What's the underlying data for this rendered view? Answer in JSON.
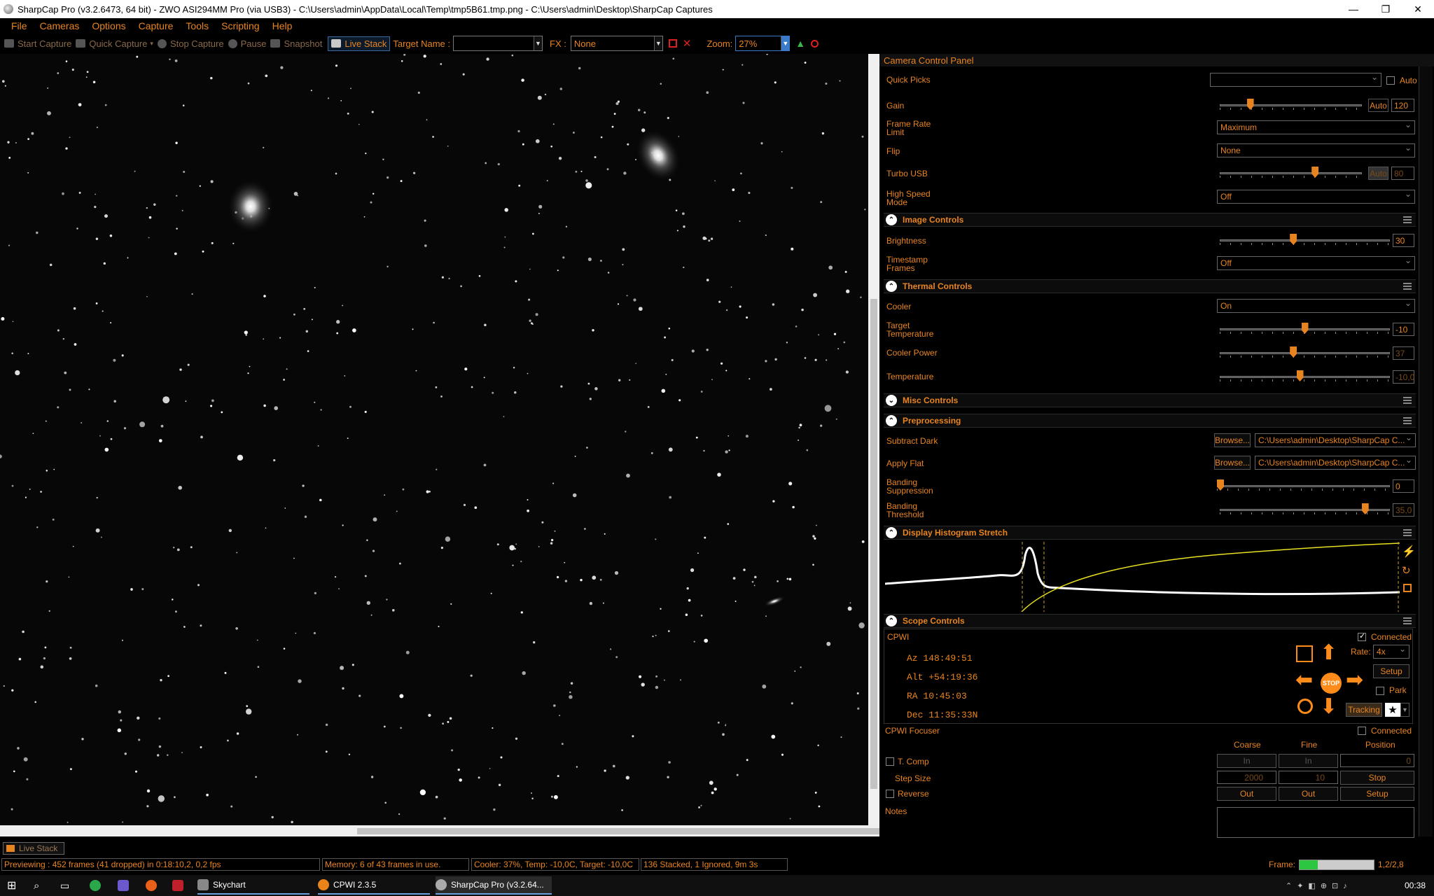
{
  "window": {
    "title": "SharpCap Pro (v3.2.6473, 64 bit) - ZWO ASI294MM Pro (via USB3) - C:\\Users\\admin\\AppData\\Local\\Temp\\tmp5B61.tmp.png - C:\\Users\\admin\\Desktop\\SharpCap Captures",
    "minimize": "—",
    "maximize": "❐",
    "close": "✕"
  },
  "menu": [
    "File",
    "Cameras",
    "Options",
    "Capture",
    "Tools",
    "Scripting",
    "Help"
  ],
  "toolbar": {
    "start_capture": "Start Capture",
    "quick_capture": "Quick Capture",
    "stop_capture": "Stop Capture",
    "pause": "Pause",
    "snapshot": "Snapshot",
    "live_stack": "Live Stack",
    "target_name_label": "Target Name :",
    "target_name_value": "",
    "fx_label": "FX :",
    "fx_value": "None",
    "zoom_label": "Zoom:",
    "zoom_value": "27%"
  },
  "panel": {
    "title": "Camera Control Panel",
    "quick_picks_label": "Quick Picks",
    "quick_picks_value": "",
    "auto_label": "Auto",
    "gain": {
      "label": "Gain",
      "auto": "Auto",
      "value": "120",
      "level": 0.2
    },
    "frame_rate": {
      "label": "Frame Rate Limit",
      "value": "Maximum"
    },
    "flip": {
      "label": "Flip",
      "value": "None"
    },
    "turbo_usb": {
      "label": "Turbo USB",
      "auto": "Auto",
      "value": "80",
      "level": 0.68
    },
    "high_speed": {
      "label": "High Speed Mode",
      "value": "Off"
    },
    "image_controls": {
      "title": "Image Controls",
      "brightness": {
        "label": "Brightness",
        "value": "30",
        "level": 0.43
      },
      "timestamp": {
        "label": "Timestamp Frames",
        "value": "Off"
      }
    },
    "thermal": {
      "title": "Thermal Controls",
      "cooler": {
        "label": "Cooler",
        "value": "On"
      },
      "target_temp": {
        "label": "Target Temperature",
        "value": "-10",
        "level": 0.5
      },
      "cooler_power": {
        "label": "Cooler Power",
        "value": "37",
        "level": 0.43
      },
      "temperature": {
        "label": "Temperature",
        "value": "-10,0",
        "level": 0.47
      }
    },
    "misc": {
      "title": "Misc Controls"
    },
    "preprocessing": {
      "title": "Preprocessing",
      "subtract_dark": {
        "label": "Subtract Dark",
        "browse": "Browse...",
        "value": "C:\\Users\\admin\\Desktop\\SharpCap C..."
      },
      "apply_flat": {
        "label": "Apply Flat",
        "browse": "Browse...",
        "value": "C:\\Users\\admin\\Desktop\\SharpCap C..."
      },
      "banding_suppression": {
        "label": "Banding Suppression",
        "value": "0",
        "level": 0.0
      },
      "banding_threshold": {
        "label": "Banding Threshold",
        "value": "35,0",
        "level": 0.87
      }
    },
    "histogram": {
      "title": "Display Histogram Stretch"
    },
    "scope": {
      "title": "Scope Controls",
      "device": "CPWI",
      "connected_label": "Connected",
      "az": "Az  148:49:51",
      "alt": "Alt +54:19:36",
      "ra": "RA  10:45:03",
      "dec": "Dec 11:35:33N",
      "rate_label": "Rate:",
      "rate_value": "4x",
      "setup": "Setup",
      "park": "Park",
      "tracking": "Tracking",
      "stop": "STOP"
    },
    "focuser": {
      "title": "CPWI Focuser",
      "connected_label": "Connected",
      "col_coarse": "Coarse",
      "col_fine": "Fine",
      "col_position": "Position",
      "tcomp": "T. Comp",
      "in1": "In",
      "in2": "In",
      "position_value": "0",
      "step_size": "Step Size",
      "coarse_step": "2000",
      "fine_step": "10",
      "stop": "Stop",
      "reverse": "Reverse",
      "out1": "Out",
      "out2": "Out",
      "setup": "Setup"
    },
    "notes_label": "Notes"
  },
  "bottom": {
    "tab_live_stack": "Live Stack",
    "status_preview": "Previewing : 452 frames (41 dropped) in 0:18:10,2, 0,2 fps",
    "status_memory": "Memory: 6 of 43 frames in use.",
    "status_cooler": "Cooler: 37%, Temp: -10,0C, Target: -10,0C",
    "status_stacked": "136 Stacked, 1 Ignored, 9m 3s",
    "frame_label": "Frame:",
    "frame_value": "1,2/2,8"
  },
  "taskbar": {
    "apps": [
      "Skychart",
      "CPWI 2.3.5",
      "SharpCap Pro (v3.2.64..."
    ],
    "clock": "00:38"
  },
  "colors": {
    "accent": "#e88420",
    "background": "#000000"
  }
}
